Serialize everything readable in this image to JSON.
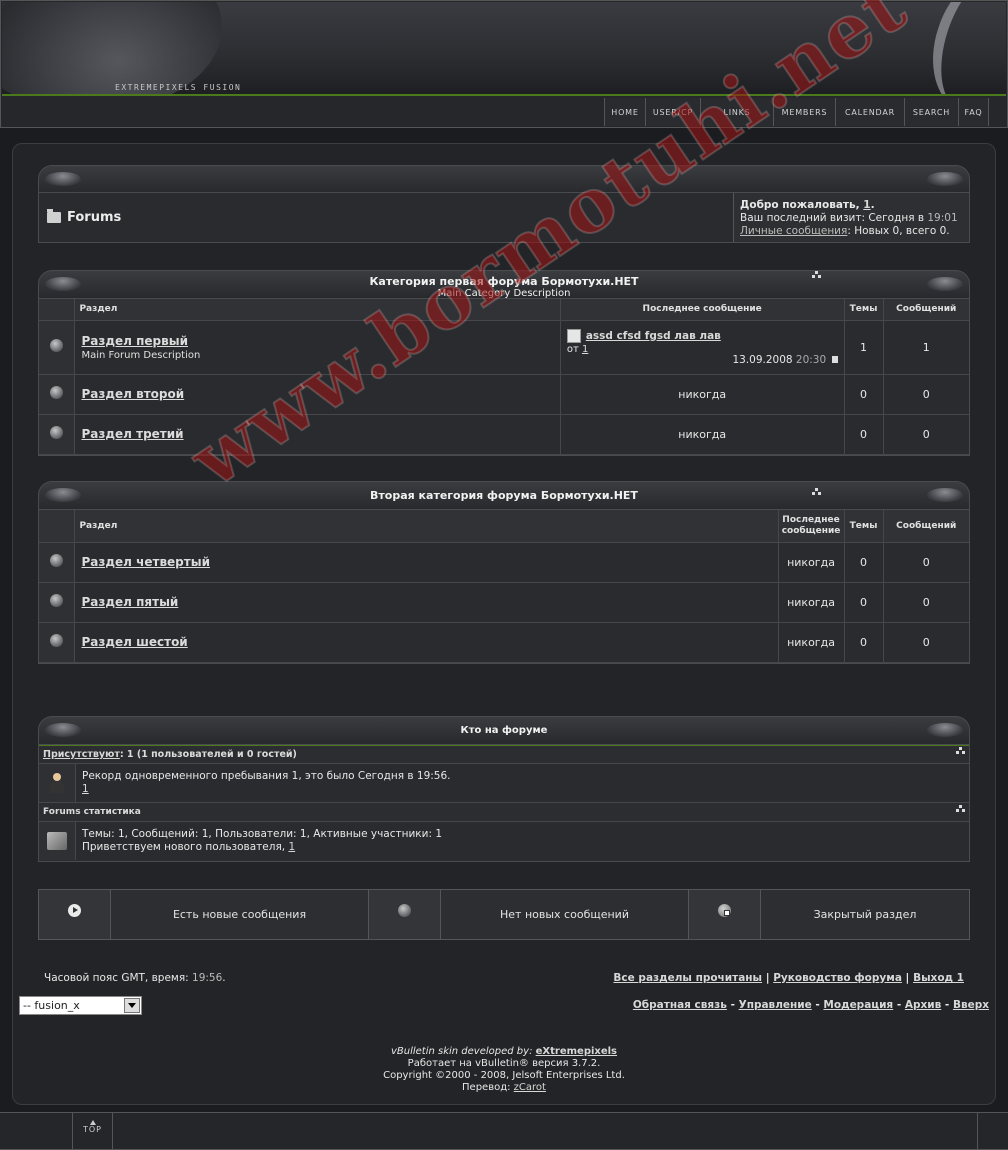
{
  "header": {
    "brand": "EXTREMEPIXELS FUSION",
    "nav": [
      "HOME",
      "USER/CP",
      "LINKS",
      "MEMBERS",
      "CALENDAR",
      "SEARCH",
      "FAQ"
    ]
  },
  "crumb": {
    "title": "Forums",
    "welcome_prefix": "Добро пожаловать, ",
    "welcome_user": "1",
    "welcome_suffix": ".",
    "last_visit_label": "Ваш последний визит: Сегодня в ",
    "last_visit_time": "19:01",
    "pm_link": "Личные сообщения",
    "pm_stats": ": Новых 0, всего 0."
  },
  "cat1": {
    "title": "Категория первая форума Бормотухи.НЕТ",
    "subtitle": "Main Category Description",
    "headers": {
      "forum": "Раздел",
      "last": "Последнее сообщение",
      "threads": "Темы",
      "posts": "Сообщений"
    },
    "forums": [
      {
        "name": "Раздел первый",
        "desc": "Main Forum Description",
        "last_title": "assd cfsd fgsd лав лав",
        "by_label": "от ",
        "by_user": "1",
        "date": "13.09.2008",
        "time": "20:30",
        "threads": "1",
        "posts": "1"
      },
      {
        "name": "Раздел второй",
        "last": "никогда",
        "threads": "0",
        "posts": "0"
      },
      {
        "name": "Раздел третий",
        "last": "никогда",
        "threads": "0",
        "posts": "0"
      }
    ]
  },
  "cat2": {
    "title": "Вторая категория форума Бормотухи.НЕТ",
    "headers": {
      "forum": "Раздел",
      "last": "Последнее сообщение",
      "threads": "Темы",
      "posts": "Сообщений"
    },
    "forums": [
      {
        "name": "Раздел четвертый",
        "last": "никогда",
        "threads": "0",
        "posts": "0"
      },
      {
        "name": "Раздел пятый",
        "last": "никогда",
        "threads": "0",
        "posts": "0"
      },
      {
        "name": "Раздел шестой",
        "last": "никогда",
        "threads": "0",
        "posts": "0"
      }
    ]
  },
  "who": {
    "title": "Кто на форуме",
    "present_link": "Присутствуют",
    "present_stats": ": 1 (1 пользователей и 0 гостей)",
    "record": "Рекорд одновременного пребывания 1, это было Сегодня в 19:56.",
    "online_user": "1",
    "stats_title": "Forums статистика",
    "stats": "Темы: 1, Сообщений: 1, Пользователи: 1, Активные участники: 1",
    "welcome_new": "Приветствуем нового пользователя, ",
    "new_user": "1"
  },
  "legend": [
    "Есть новые сообщения",
    "Нет новых сообщений",
    "Закрытый раздел"
  ],
  "bottom": {
    "tz_label": "Часовой пояс GMT, время: ",
    "tz_time": "19:56",
    "tz_end": ".",
    "links1": [
      "Все разделы прочитаны",
      "Руководство форума",
      "Выход 1"
    ],
    "links2": [
      "Обратная связь",
      "Управление",
      "Модерация",
      "Архив",
      "Вверх"
    ],
    "style_select": "-- fusion_x",
    "credit_label": "vBulletin skin developed by: ",
    "credit_link": "eXtremepixels",
    "powered": "Работает на vBulletin® версия 3.7.2.",
    "copyright": "Copyright ©2000 - 2008, Jelsoft Enterprises Ltd.",
    "translation_label": "Перевод: ",
    "translation_link": "zCarot",
    "top": "TOP"
  },
  "watermark": "www.bormotuhi.net"
}
